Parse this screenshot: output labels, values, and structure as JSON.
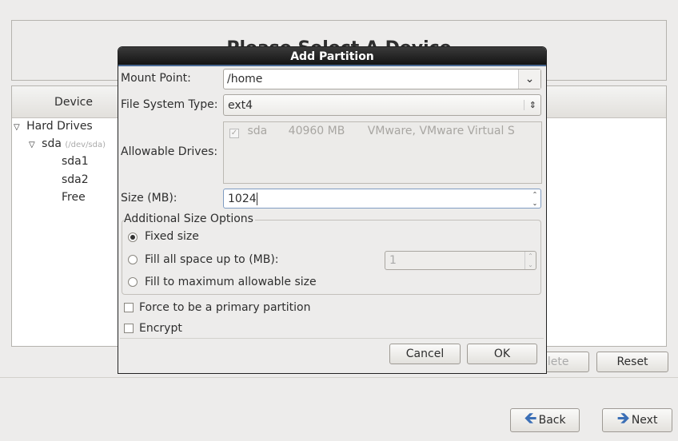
{
  "background": {
    "heading": "Please Select A Device",
    "column_device": "Device",
    "tree": [
      {
        "label": "Hard Drives",
        "level": 0
      },
      {
        "label": "sda",
        "sub": "(/dev/sda)",
        "level": 1
      },
      {
        "label": "sda1",
        "level": 2
      },
      {
        "label": "sda2",
        "level": 2
      },
      {
        "label": "Free",
        "level": 2
      }
    ],
    "delete_label": "Delete",
    "reset_label": "Reset",
    "back_label": "Back",
    "next_label": "Next"
  },
  "dialog": {
    "title": "Add Partition",
    "mount_point_label": "Mount Point:",
    "mount_point_value": "/home",
    "fs_type_label": "File System Type:",
    "fs_type_value": "ext4",
    "drives_label": "Allowable Drives:",
    "drive": {
      "checked": true,
      "name": "sda",
      "size": "40960 MB",
      "model": "VMware, VMware Virtual S"
    },
    "size_label": "Size (MB):",
    "size_value": "1024",
    "additional_label": "Additional Size Options",
    "options": [
      {
        "label": "Fixed size",
        "selected": true
      },
      {
        "label": "Fill all space up to (MB):",
        "selected": false
      },
      {
        "label": "Fill to maximum allowable size",
        "selected": false
      }
    ],
    "fill_up_value": "1",
    "primary_label": "Force to be a primary partition",
    "encrypt_label": "Encrypt",
    "cancel_label": "Cancel",
    "ok_label": "OK"
  },
  "colors": {
    "titlebar": "#1e1e1e",
    "arrow": "#3b6fb6"
  }
}
